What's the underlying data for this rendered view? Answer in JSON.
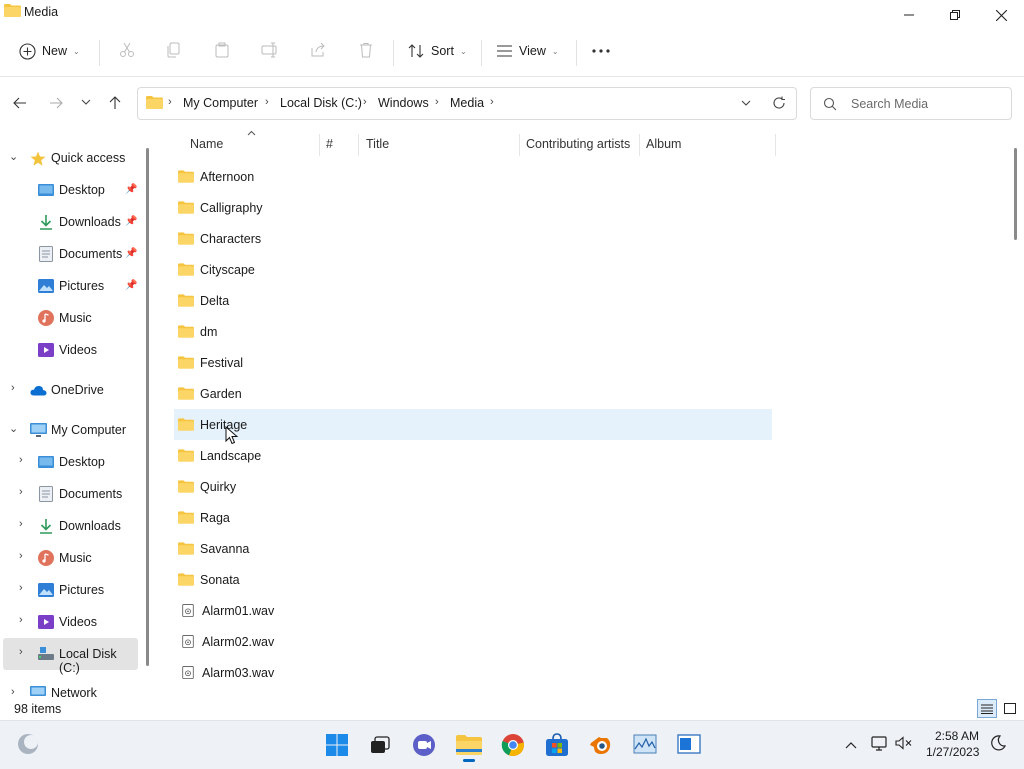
{
  "window": {
    "title": "Media"
  },
  "commands": {
    "new_label": "New",
    "sort_label": "Sort",
    "view_label": "View"
  },
  "address": {
    "crumbs": [
      "My Computer",
      "Local Disk (C:)",
      "Windows",
      "Media"
    ]
  },
  "search": {
    "placeholder": "Search Media"
  },
  "nav": {
    "quick_access": "Quick access",
    "quick_items": [
      {
        "label": "Desktop",
        "icon": "desktop-icon",
        "pinned": true
      },
      {
        "label": "Downloads",
        "icon": "download-icon",
        "pinned": true
      },
      {
        "label": "Documents",
        "icon": "documents-icon",
        "pinned": true
      },
      {
        "label": "Pictures",
        "icon": "pictures-icon",
        "pinned": true
      },
      {
        "label": "Music",
        "icon": "music-icon",
        "pinned": false
      },
      {
        "label": "Videos",
        "icon": "videos-icon",
        "pinned": false
      }
    ],
    "onedrive": "OneDrive",
    "my_computer": "My Computer",
    "computer_items": [
      {
        "label": "Desktop",
        "icon": "desktop-icon"
      },
      {
        "label": "Documents",
        "icon": "documents-icon"
      },
      {
        "label": "Downloads",
        "icon": "download-icon"
      },
      {
        "label": "Music",
        "icon": "music-icon"
      },
      {
        "label": "Pictures",
        "icon": "pictures-icon"
      },
      {
        "label": "Videos",
        "icon": "videos-icon"
      },
      {
        "label": "Local Disk (C:)",
        "icon": "drive-icon"
      }
    ],
    "network": "Network"
  },
  "columns": {
    "name": "Name",
    "number": "#",
    "title": "Title",
    "artists": "Contributing artists",
    "album": "Album"
  },
  "files": [
    {
      "name": "Afternoon",
      "type": "folder"
    },
    {
      "name": "Calligraphy",
      "type": "folder"
    },
    {
      "name": "Characters",
      "type": "folder"
    },
    {
      "name": "Cityscape",
      "type": "folder"
    },
    {
      "name": "Delta",
      "type": "folder"
    },
    {
      "name": "dm",
      "type": "folder"
    },
    {
      "name": "Festival",
      "type": "folder"
    },
    {
      "name": "Garden",
      "type": "folder"
    },
    {
      "name": "Heritage",
      "type": "folder",
      "selected": true
    },
    {
      "name": "Landscape",
      "type": "folder"
    },
    {
      "name": "Quirky",
      "type": "folder"
    },
    {
      "name": "Raga",
      "type": "folder"
    },
    {
      "name": "Savanna",
      "type": "folder"
    },
    {
      "name": "Sonata",
      "type": "folder"
    },
    {
      "name": "Alarm01.wav",
      "type": "audio"
    },
    {
      "name": "Alarm02.wav",
      "type": "audio"
    },
    {
      "name": "Alarm03.wav",
      "type": "audio"
    }
  ],
  "status": {
    "item_count": "98 items"
  },
  "clock": {
    "time": "2:58 AM",
    "date": "1/27/2023"
  },
  "colors": {
    "folder": "#f5c542",
    "accent": "#0067c0",
    "selection": "#e5f1fb"
  }
}
